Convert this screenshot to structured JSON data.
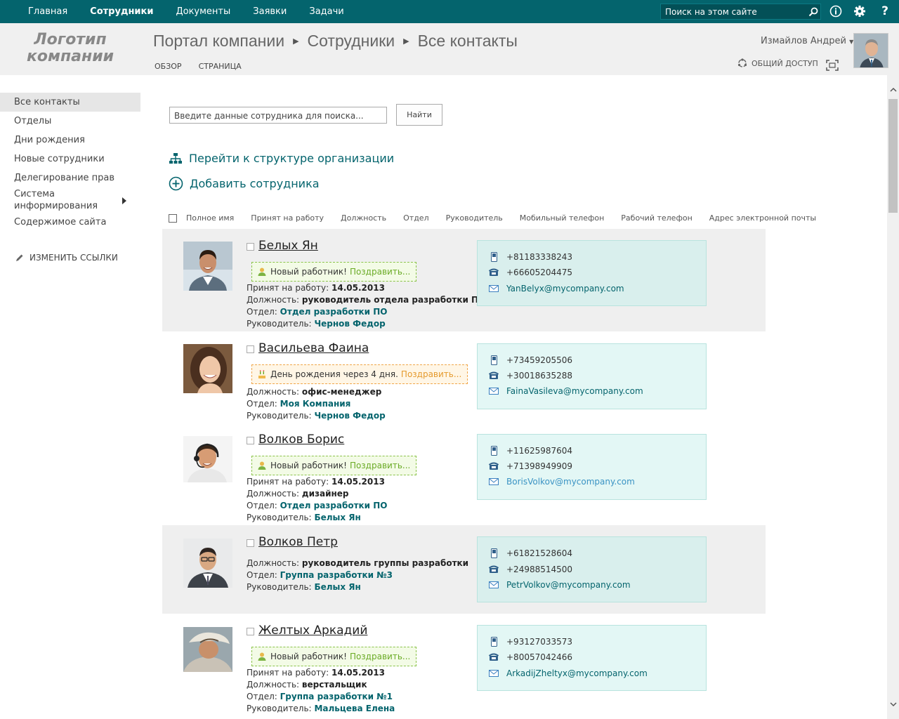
{
  "topnav": {
    "items": [
      "Главная",
      "Сотрудники",
      "Документы",
      "Заявки",
      "Задачи"
    ],
    "active_index": 1,
    "search_placeholder": "Поиск на этом сайте"
  },
  "header": {
    "logo_line1": "Логотип",
    "logo_line2": "компании",
    "breadcrumb": [
      "Портал компании",
      "Сотрудники",
      "Все контакты"
    ],
    "subtabs": [
      "ОБЗОР",
      "СТРАНИЦА"
    ],
    "user_name": "Измайлов Андрей",
    "share_label": "ОБЩИЙ ДОСТУП"
  },
  "leftnav": {
    "items": [
      "Все контакты",
      "Отделы",
      "Дни рождения",
      "Новые сотрудники",
      "Делегирование прав",
      "Система информирования",
      "Содержимое сайта"
    ],
    "edit_links": "ИЗМЕНИТЬ ССЫЛКИ"
  },
  "search": {
    "placeholder": "Введите данные сотрудника для поиска...",
    "button": "Найти"
  },
  "actions": {
    "org_structure": "Перейти к структуре организации",
    "add_employee": "Добавить сотрудника"
  },
  "columns": [
    "Полное имя",
    "Принят на работу",
    "Должность",
    "Отдел",
    "Руководитель",
    "Мобильный телефон",
    "Рабочий телефон",
    "Адрес электронной почты"
  ],
  "labels": {
    "hired": "Принят на работу:",
    "position": "Должность:",
    "department": "Отдел:",
    "manager": "Руководитель:",
    "congratulate": "Поздравить..."
  },
  "employees": [
    {
      "name": "Белых Ян",
      "badge": "Новый работник!",
      "hired": "14.05.2013",
      "position": "руководитель отдела разработки ПО",
      "department": "Отдел разработки ПО",
      "manager": "Чернов Федор",
      "mobile": "+81183338243",
      "work_phone": "+66605204475",
      "email": "YanBelyx@mycompany.com"
    },
    {
      "name": "Васильева Фаина",
      "badge": "День рождения через 4 дня.",
      "position": "офис-менеджер",
      "department": "Моя Компания",
      "manager": "Чернов Федор",
      "mobile": "+73459205506",
      "work_phone": "+30018635288",
      "email": "FainaVasileva@mycompany.com"
    },
    {
      "name": "Волков Борис",
      "badge": "Новый работник!",
      "hired": "14.05.2013",
      "position": "дизайнер",
      "department": "Отдел разработки ПО",
      "manager": "Белых Ян",
      "mobile": "+11625987604",
      "work_phone": "+71398949909",
      "email": "BorisVolkov@mycompany.com"
    },
    {
      "name": "Волков Петр",
      "position": "руководитель группы разработки",
      "department": "Группа разработки №3",
      "manager": "Белых Ян",
      "mobile": "+61821528604",
      "work_phone": "+24988514500",
      "email": "PetrVolkov@mycompany.com"
    },
    {
      "name": "Желтых Аркадий",
      "badge": "Новый работник!",
      "hired": "14.05.2013",
      "position": "верстальщик",
      "department": "Группа разработки №1",
      "manager": "Мальцева Елена",
      "mobile": "+93127033573",
      "work_phone": "+80057042466",
      "email": "ArkadijZheltyx@mycompany.com"
    }
  ]
}
